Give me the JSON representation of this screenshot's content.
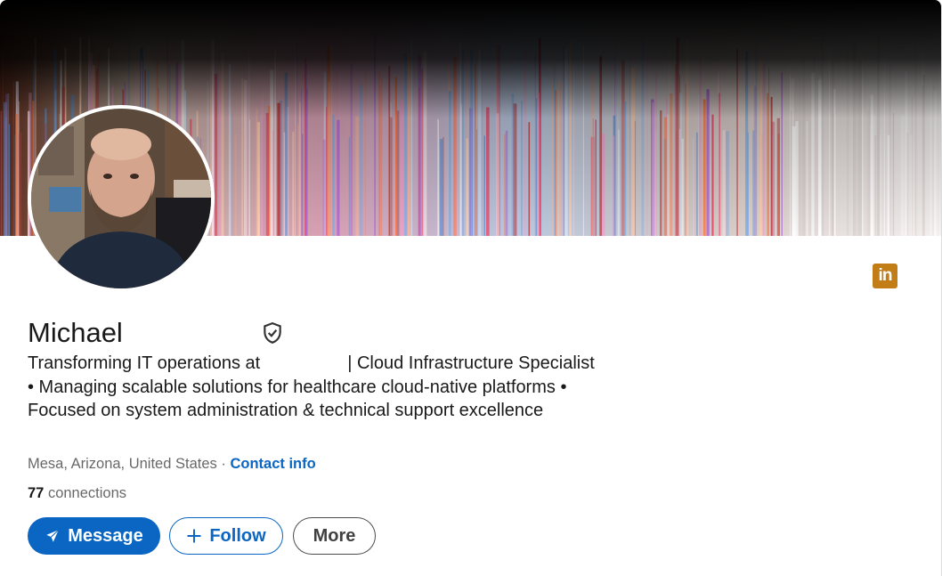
{
  "profile": {
    "name": "Michael",
    "headline_part1": "Transforming IT operations at",
    "headline_part2": "| Cloud Infrastructure Specialist • Managing scalable solutions for healthcare cloud-native platforms • Focused on system administration & technical support excellence",
    "location": "Mesa, Arizona, United States",
    "separator": " · ",
    "contact_info_label": "Contact info",
    "connections_count": "77",
    "connections_label": " connections"
  },
  "badge": {
    "linkedin_text": "in"
  },
  "actions": {
    "message_label": "Message",
    "follow_label": "Follow",
    "more_label": "More"
  },
  "icons": {
    "verified": "shield-check-icon",
    "message": "paper-plane-icon",
    "follow": "plus-icon",
    "linkedin": "linkedin-logo-icon"
  },
  "colors": {
    "accent": "#0a66c2",
    "linkedin_badge": "#c37d16"
  }
}
